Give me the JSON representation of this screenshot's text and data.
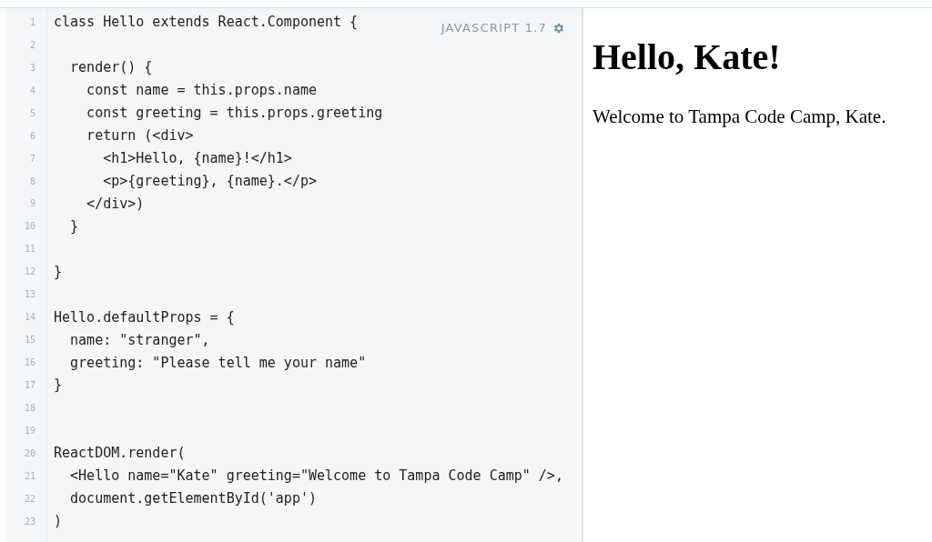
{
  "editor": {
    "language_label": "JAVASCRIPT 1.7",
    "lines": [
      {
        "number": "1",
        "text": "class Hello extends React.Component {"
      },
      {
        "number": "2"
      },
      {
        "number": "3",
        "text": "  render() {"
      },
      {
        "number": "4",
        "text": "    const name = this.props.name"
      },
      {
        "number": "5",
        "text": "    const greeting = this.props.greeting"
      },
      {
        "number": "6",
        "text": "    return (<div>"
      },
      {
        "number": "7",
        "text": "      <h1>Hello, {name}!</h1>"
      },
      {
        "number": "8",
        "text": "      <p>{greeting}, {name}.</p>"
      },
      {
        "number": "9",
        "text": "    </div>)"
      },
      {
        "number": "10",
        "text": "  }"
      },
      {
        "number": "11"
      },
      {
        "number": "12",
        "text": "}"
      },
      {
        "number": "13"
      },
      {
        "number": "14",
        "text": "Hello.defaultProps = {"
      },
      {
        "number": "15",
        "text": "  name: \"stranger\","
      },
      {
        "number": "16",
        "text": "  greeting: \"Please tell me your name\""
      },
      {
        "number": "17",
        "text": "}"
      },
      {
        "number": "18"
      },
      {
        "number": "19"
      },
      {
        "number": "20",
        "text": "ReactDOM.render("
      },
      {
        "number": "21",
        "text": "  <Hello name=\"Kate\" greeting=\"Welcome to Tampa Code Camp\" />,"
      },
      {
        "number": "22",
        "text": "  document.getElementById('app')"
      },
      {
        "number": "23",
        "text": ")"
      }
    ]
  },
  "preview": {
    "heading": "Hello, Kate!",
    "paragraph": "Welcome to Tampa Code Camp, Kate."
  }
}
